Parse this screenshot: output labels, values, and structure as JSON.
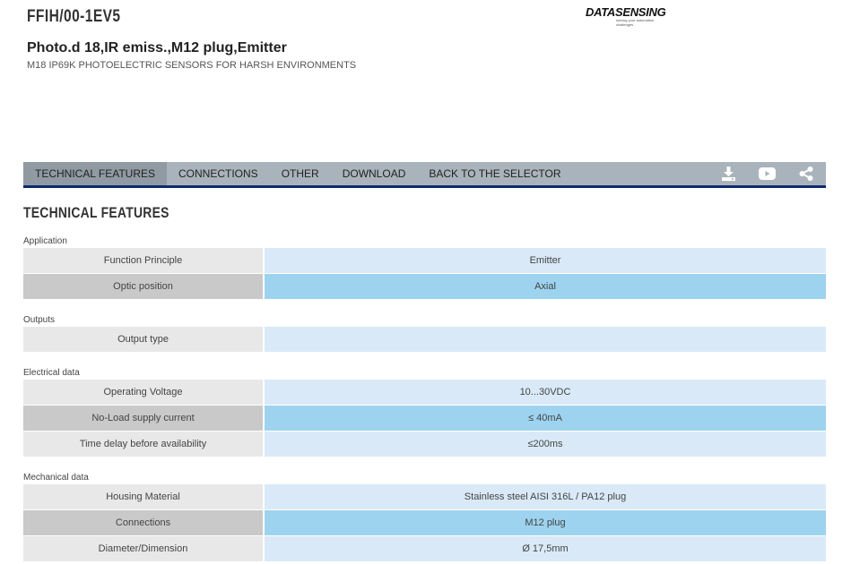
{
  "product": {
    "code": "FFIH/00-1EV5",
    "title": "Photo.d 18,IR emiss.,M12 plug,Emitter",
    "subtitle": "M18 IP69K PHOTOELECTRIC SENSORS FOR HARSH ENVIRONMENTS"
  },
  "logo": {
    "text": "DATASENSING",
    "tagline": "solving your automation challenges"
  },
  "tabs": [
    {
      "label": "TECHNICAL FEATURES",
      "active": true
    },
    {
      "label": "CONNECTIONS",
      "active": false
    },
    {
      "label": "OTHER",
      "active": false
    },
    {
      "label": "DOWNLOAD",
      "active": false
    },
    {
      "label": "BACK TO THE SELECTOR",
      "active": false
    }
  ],
  "tab_icons": [
    "download-icon",
    "youtube-icon",
    "share-icon"
  ],
  "section_title": "TECHNICAL FEATURES",
  "groups": [
    {
      "label": "Application",
      "rows": [
        {
          "label": "Function Principle",
          "value": "Emitter"
        },
        {
          "label": "Optic position",
          "value": "Axial"
        }
      ]
    },
    {
      "label": "Outputs",
      "rows": [
        {
          "label": "Output type",
          "value": ""
        }
      ]
    },
    {
      "label": "Electrical data",
      "rows": [
        {
          "label": "Operating Voltage",
          "value": "10...30VDC"
        },
        {
          "label": "No-Load supply current",
          "value": "≤ 40mA"
        },
        {
          "label": "Time delay before availability",
          "value": "≤200ms"
        }
      ]
    },
    {
      "label": "Mechanical data",
      "rows": [
        {
          "label": "Housing Material",
          "value": "Stainless steel AISI 316L / PA12 plug"
        },
        {
          "label": "Connections",
          "value": "M12 plug"
        },
        {
          "label": "Diameter/Dimension",
          "value": "Ø 17,5mm"
        }
      ]
    }
  ],
  "colors": {
    "tabbar_bg": "#a9b3bb",
    "tab_active_bg": "#8f9aa3",
    "tabbar_border": "#0d2a6b",
    "label_light": "#e8e8e8",
    "label_dark": "#c9c9c9",
    "value_light": "#d9e9f7",
    "value_dark": "#9dd3ef"
  }
}
